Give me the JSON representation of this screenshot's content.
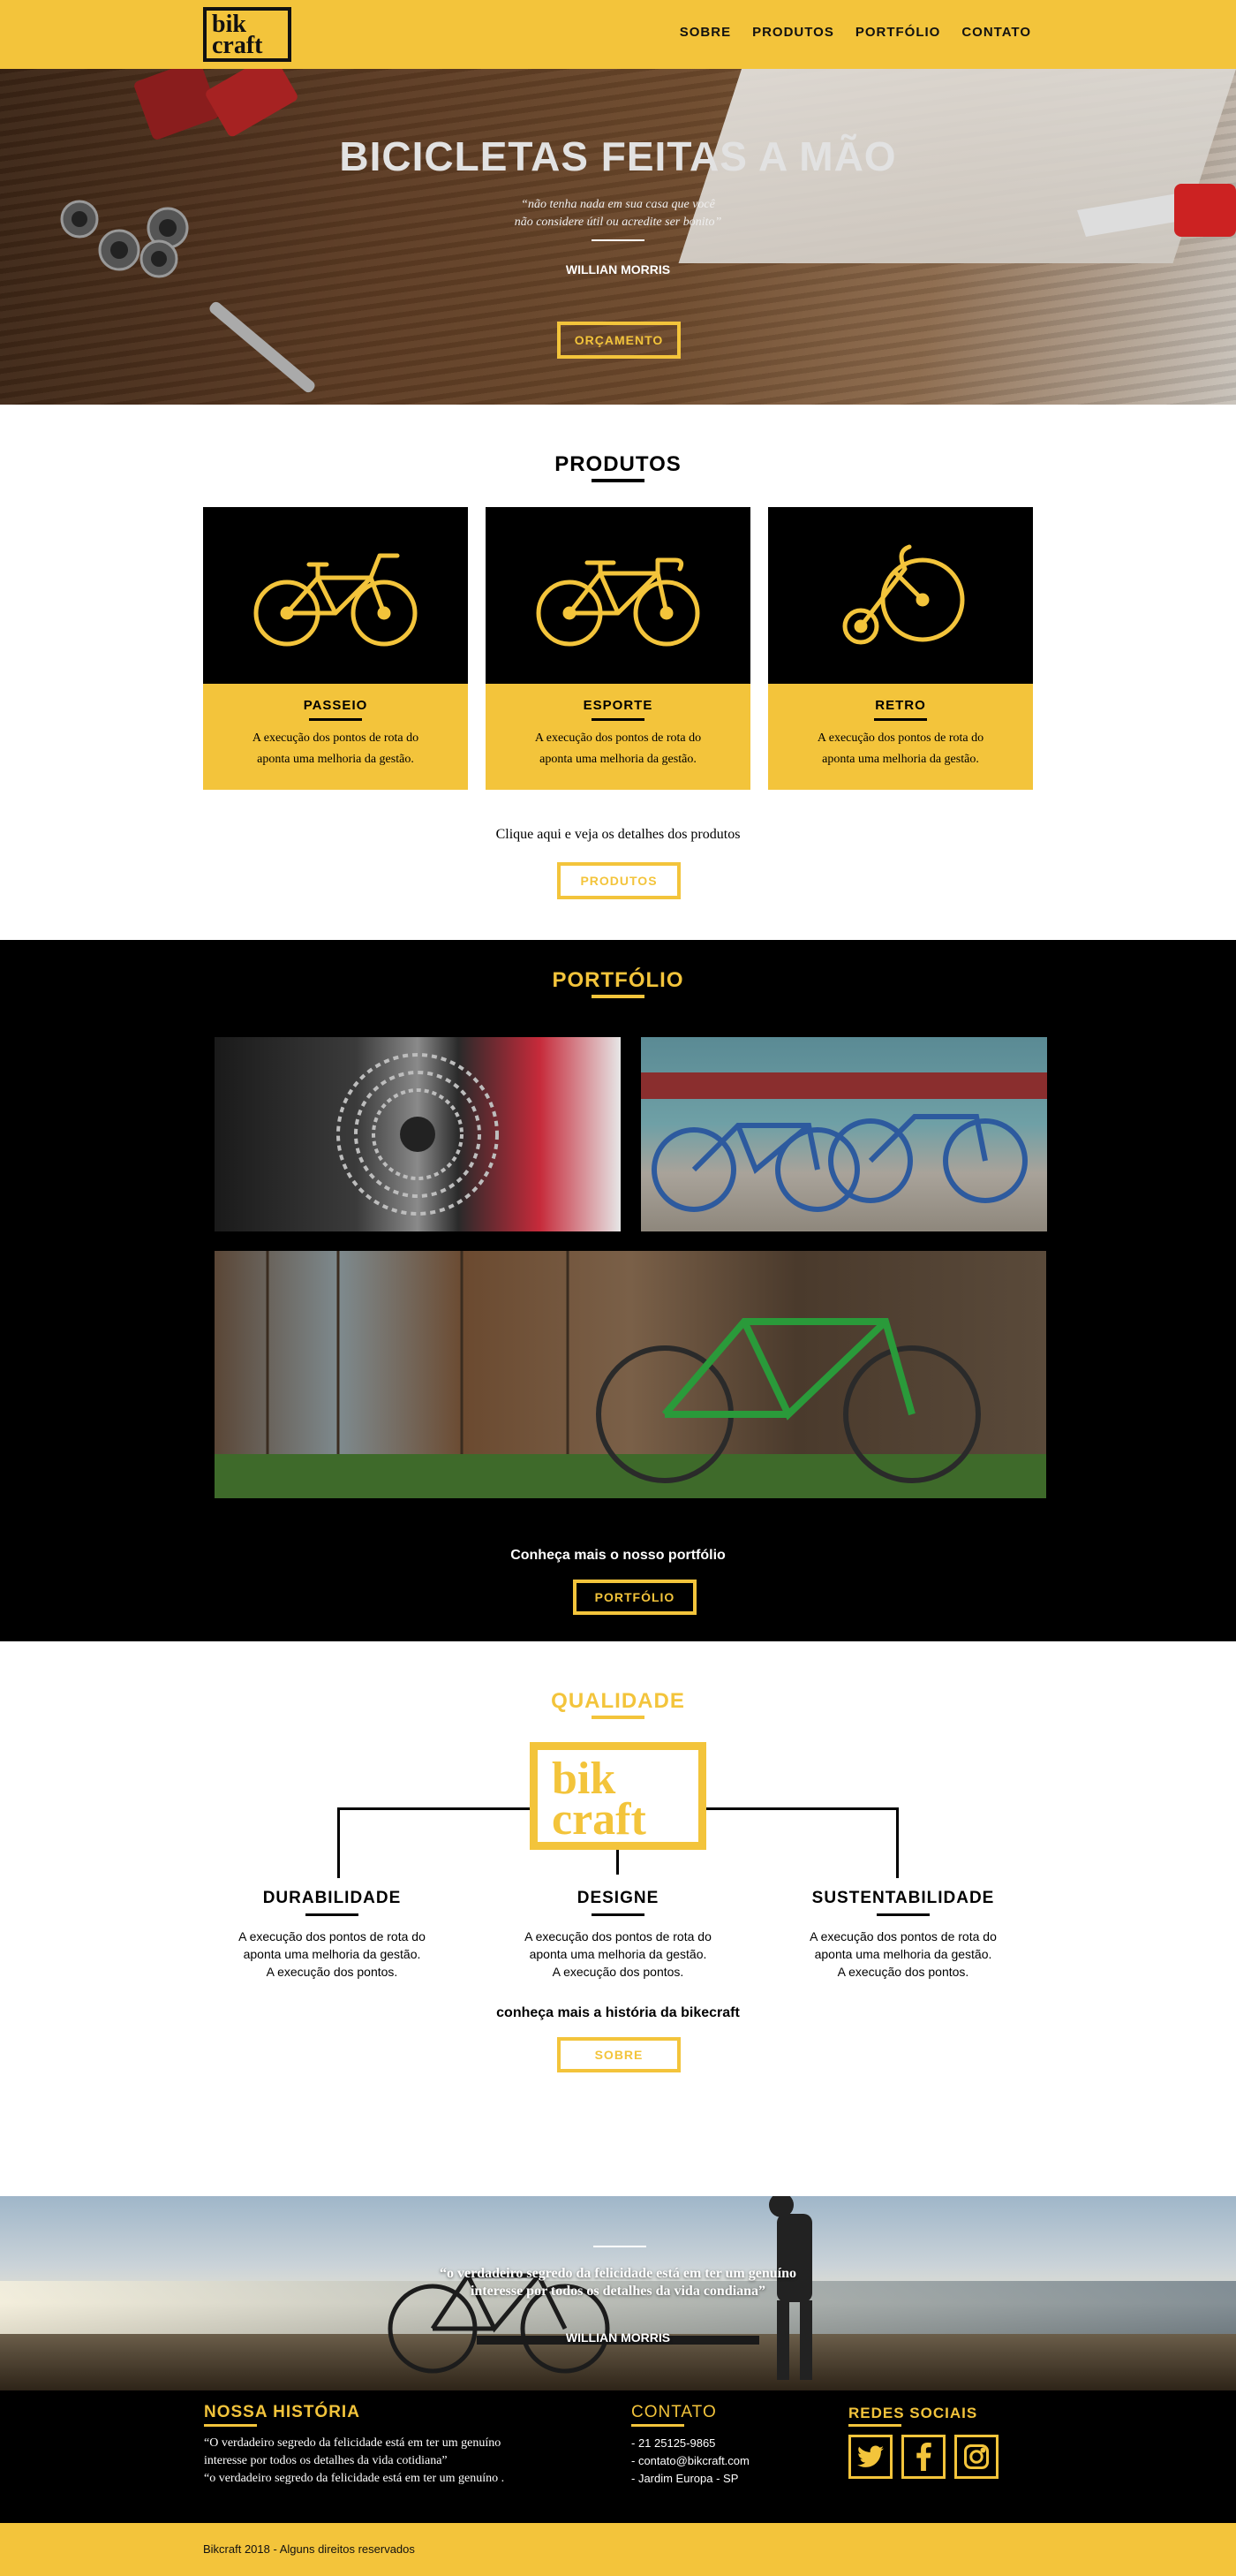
{
  "header": {
    "logo_line1": "bik",
    "logo_line2": "craft",
    "nav": [
      "SOBRE",
      "PRODUTOS",
      "PORTFÓLIO",
      "CONTATO"
    ]
  },
  "hero": {
    "title": "BICICLETAS FEITAS A MÃO",
    "quote_line1": "“não tenha nada em sua casa que você",
    "quote_line2": "não considere útil ou acredite ser bonito”",
    "author": "WILLIAN MORRIS",
    "button": "ORÇAMENTO"
  },
  "produtos": {
    "title": "PRODUTOS",
    "cards": [
      {
        "name": "PASSEIO",
        "desc": "A execução dos pontos de rota do aponta uma melhoria da gestão.",
        "icon": "city-bike-icon"
      },
      {
        "name": "ESPORTE",
        "desc": "A execução dos pontos de rota do aponta uma melhoria da gestão.",
        "icon": "sport-bike-icon"
      },
      {
        "name": "RETRO",
        "desc": "A execução dos pontos de rota do aponta uma melhoria da gestão.",
        "icon": "penny-farthing-icon"
      }
    ],
    "cta_text": "Clique aqui e veja os detalhes dos produtos",
    "button": "PRODUTOS"
  },
  "portfolio": {
    "title": "PORTFÓLIO",
    "cta_text": "Conheça mais o nosso portfólio",
    "button": "PORTFÓLIO"
  },
  "qualidade": {
    "title": "QUALIDADE",
    "logo_line1": "bik",
    "logo_line2": "craft",
    "items": [
      {
        "name": "DURABILIDADE",
        "desc1": "A execução dos pontos de rota do",
        "desc2": "aponta uma melhoria da gestão.",
        "desc3": "A execução dos pontos."
      },
      {
        "name": "DESIGNE",
        "desc1": "A execução dos pontos de rota do",
        "desc2": "aponta uma melhoria da gestão.",
        "desc3": "A execução dos pontos."
      },
      {
        "name": "SUSTENTABILIDADE",
        "desc1": "A execução dos pontos de rota do",
        "desc2": "aponta uma melhoria da gestão.",
        "desc3": "A execução dos pontos."
      }
    ],
    "cta_text": "conheça mais a história da bikecraft",
    "button": "SOBRE"
  },
  "banner": {
    "quote_line1": "“o verdadeiro segredo da felicidade está em ter um genuíno",
    "quote_line2": "interesse por todos os detalhes da vida condiana”",
    "author": "WILLIAN MORRIS"
  },
  "footer": {
    "historia_title": "NOSSA HISTÓRIA",
    "historia_line1": "“O verdadeiro segredo da felicidade está em ter um genuíno",
    "historia_line2": "interesse por todos os detalhes da vida cotidiana”",
    "historia_line3": "“o verdadeiro segredo da felicidade está em ter um genuíno .",
    "contato_title": "CONTATO",
    "contato_items": [
      "- 21 25125-9865",
      "- contato@bikcraft.com",
      "- Jardim Europa - SP"
    ],
    "redes_title": "REDES SOCIAIS",
    "social": [
      "twitter-icon",
      "facebook-icon",
      "instagram-icon"
    ],
    "copyright": "Bikcraft 2018 - Alguns direitos reservados"
  },
  "colors": {
    "accent": "#f3c43b",
    "dark": "#000000"
  }
}
